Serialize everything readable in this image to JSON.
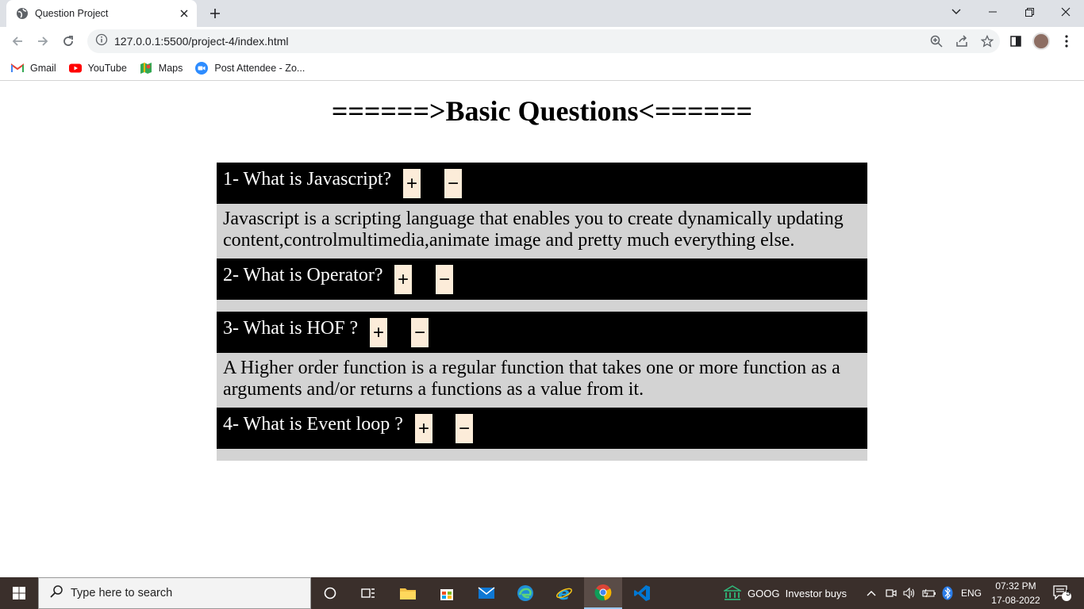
{
  "browser": {
    "tab_title": "Question Project",
    "url": "127.0.0.1:5500/project-4/index.html",
    "bookmarks": [
      {
        "label": "Gmail",
        "icon": "gmail-icon"
      },
      {
        "label": "YouTube",
        "icon": "youtube-icon"
      },
      {
        "label": "Maps",
        "icon": "maps-icon"
      },
      {
        "label": "Post Attendee - Zo...",
        "icon": "zoom-icon"
      }
    ]
  },
  "page": {
    "title": "======>Basic Questions<======",
    "questions": [
      {
        "text": "1- What is Javascript?",
        "plus": "+",
        "minus": "−",
        "answer": "Javascript is a scripting language that enables you to create dynamically updating content,controlmultimedia,animate image and pretty much everything else."
      },
      {
        "text": "2- What is Operator?",
        "plus": "+",
        "minus": "−",
        "answer": ""
      },
      {
        "text": "3- What is HOF ?",
        "plus": "+",
        "minus": "−",
        "answer": "A Higher order function is a regular function that takes one or more function as a arguments and/or returns a functions as a value from it."
      },
      {
        "text": "4- What is Event loop ?",
        "plus": "+",
        "minus": "−",
        "answer": ""
      }
    ]
  },
  "taskbar": {
    "search_placeholder": "Type here to search",
    "news": "GOOG  Investor buys",
    "language": "ENG",
    "time": "07:32 PM",
    "date": "17-08-2022",
    "notification_count": "5"
  }
}
